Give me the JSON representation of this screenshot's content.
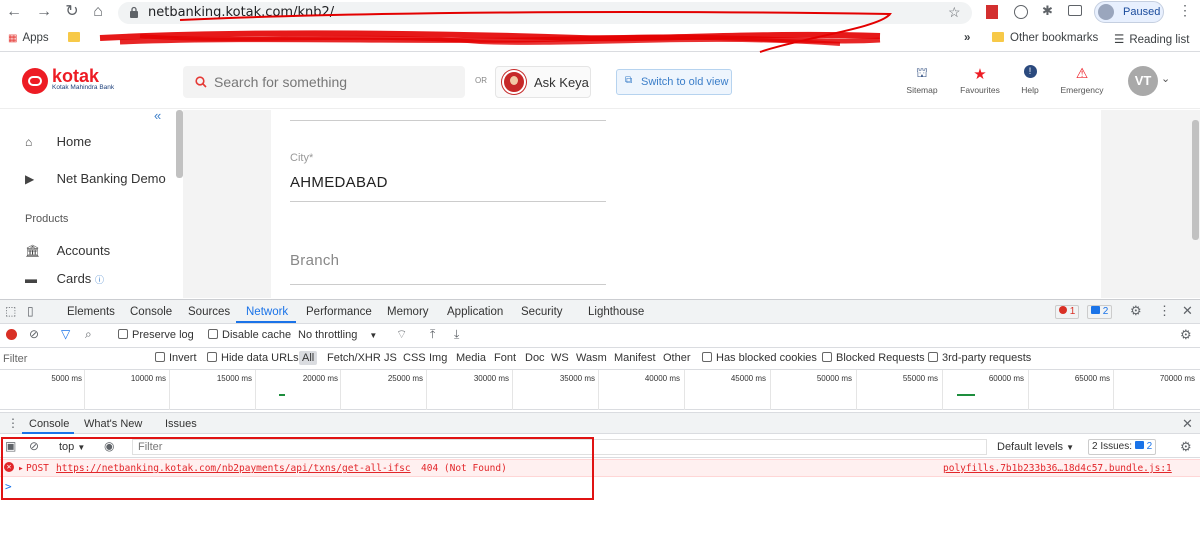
{
  "browser": {
    "url": "netbanking.kotak.com/knb2/",
    "profile_status": "Paused",
    "bookmarks": {
      "apps": "Apps",
      "overflow": "»",
      "other": "Other bookmarks",
      "reading_list": "Reading list"
    }
  },
  "header": {
    "logo": "kotak",
    "logo_sub": "Kotak Mahindra Bank",
    "search_placeholder": "Search for something",
    "or": "OR",
    "ask_keya": "Ask Keya",
    "old_view": "Switch to old view",
    "icons": [
      {
        "label": "Sitemap",
        "icon": "sitemap-icon"
      },
      {
        "label": "Favourites",
        "icon": "star-icon"
      },
      {
        "label": "Help",
        "icon": "help-icon"
      },
      {
        "label": "Emergency",
        "icon": "alarm-icon"
      }
    ],
    "avatar": "VT"
  },
  "sidebar": {
    "collapse": "«",
    "items": [
      {
        "label": "Home"
      },
      {
        "label": "Net Banking Demo"
      }
    ],
    "section": "Products",
    "products": [
      {
        "label": "Accounts"
      },
      {
        "label": "Cards"
      }
    ]
  },
  "form": {
    "city_label": "City*",
    "city_value": "AHMEDABAD",
    "branch_label": "Branch"
  },
  "devtools": {
    "tabs": [
      "Elements",
      "Console",
      "Sources",
      "Network",
      "Performance",
      "Memory",
      "Application",
      "Security",
      "Lighthouse"
    ],
    "active_tab": "Network",
    "error_count": "1",
    "message_count": "2",
    "toolbar": {
      "preserve_log": "Preserve log",
      "disable_cache": "Disable cache",
      "throttling": "No throttling"
    },
    "filter_row": {
      "filter": "Filter",
      "invert": "Invert",
      "hide_data_urls": "Hide data URLs",
      "types": [
        "All",
        "Fetch/XHR",
        "JS",
        "CSS",
        "Img",
        "Media",
        "Font",
        "Doc",
        "WS",
        "Wasm",
        "Manifest",
        "Other"
      ],
      "blocked_cookies": "Has blocked cookies",
      "blocked_requests": "Blocked Requests",
      "third_party": "3rd-party requests"
    },
    "timeline": [
      "5000 ms",
      "10000 ms",
      "15000 ms",
      "20000 ms",
      "25000 ms",
      "30000 ms",
      "35000 ms",
      "40000 ms",
      "45000 ms",
      "50000 ms",
      "55000 ms",
      "60000 ms",
      "65000 ms",
      "70000 ms"
    ],
    "drawer_tabs": [
      "Console",
      "What's New",
      "Issues"
    ],
    "console": {
      "context": "top",
      "filter": "Filter",
      "levels": "Default levels",
      "issues": "2 Issues:",
      "issues_count": "2",
      "error": {
        "method": "POST",
        "url": "https://netbanking.kotak.com/nb2payments/api/txns/get-all-ifsc",
        "status": "404 (Not Found)",
        "source": "polyfills.7b1b233b36…18d4c57.bundle.js:1"
      },
      "prompt": ">"
    }
  },
  "colors": {
    "brand_red": "#ed1c24",
    "devtools_blue": "#1a73e8",
    "error_red": "#e2262a"
  }
}
